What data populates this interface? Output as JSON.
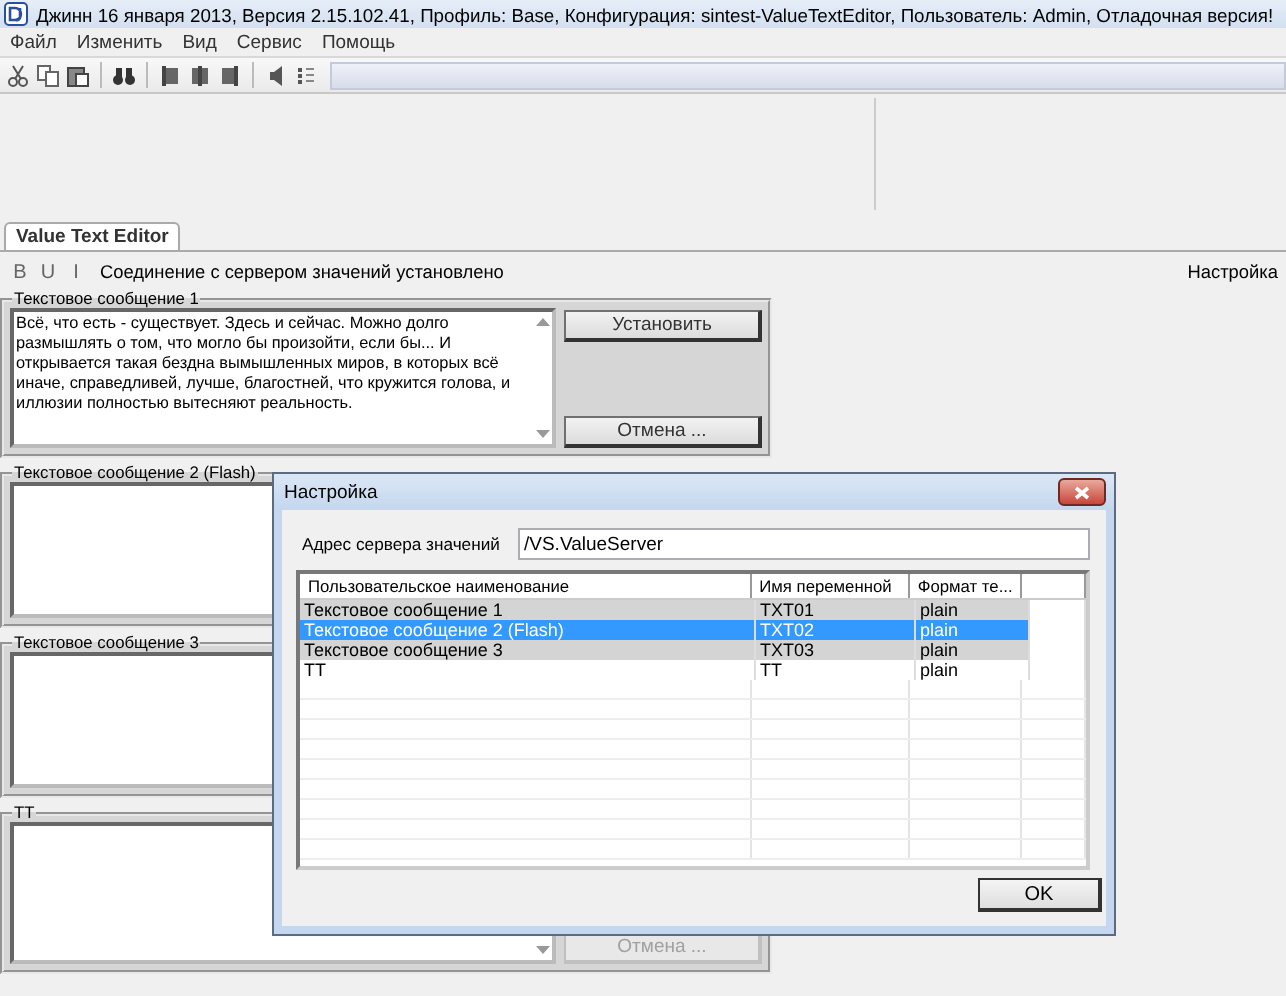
{
  "window": {
    "title": "Джинн 16 января 2013, Версия 2.15.102.41, Профиль: Base, Конфигурация: sintest-ValueTextEditor, Пользователь: Admin, Отладочная версия!"
  },
  "menu": [
    {
      "label": "Файл"
    },
    {
      "label": "Изменить"
    },
    {
      "label": "Вид"
    },
    {
      "label": "Сервис"
    },
    {
      "label": "Помощь"
    }
  ],
  "tabs": [
    {
      "label": "Value Text Editor",
      "selected": true
    }
  ],
  "format_toolbar": {
    "buttons": [
      {
        "label": "B"
      },
      {
        "label": "U"
      },
      {
        "label": "I"
      }
    ],
    "status": "Соединение с сервером значений установлено",
    "settings": "Настройка"
  },
  "messages": [
    {
      "title": "Текстовое сообщение 1",
      "text": "Всё, что есть - существует. Здесь и сейчас. Можно долго размышлять о том, что могло бы произойти, если бы... И открывается такая бездна вымышленных миров, в которых всё иначе, справедливей, лучше, благостней, что кружится голова, и иллюзии полностью вытесняют реальность.",
      "buttons": [
        {
          "kind": "set",
          "label": "Установить",
          "disabled": false
        },
        {
          "kind": "cancel",
          "label": "Отмена ...",
          "disabled": false
        }
      ]
    },
    {
      "title": "Текстовое сообщение 2 (Flash)"
    },
    {
      "title": "Текстовое сообщение 3"
    },
    {
      "title": "TT",
      "buttons": [
        {
          "kind": "cancel",
          "label": "Отмена ...",
          "disabled": true
        }
      ]
    }
  ],
  "dialog": {
    "title": "Настройка",
    "server_label": "Адрес сервера значений",
    "server_value": "/VS.ValueServer",
    "table": {
      "columns": [
        "Пользовательское наименование",
        "Имя переменной",
        "Формат те..."
      ],
      "rows": [
        {
          "cells": [
            "Текстовое сообщение 1",
            "TXT01",
            "plain"
          ],
          "selected": false,
          "shaded": true
        },
        {
          "cells": [
            "Текстовое сообщение 2 (Flash)",
            "TXT02",
            "plain"
          ],
          "selected": true
        },
        {
          "cells": [
            "Текстовое сообщение 3",
            "TXT03",
            "plain"
          ],
          "selected": false,
          "shaded": true
        },
        {
          "cells": [
            "TT",
            "TT",
            "plain"
          ],
          "selected": false,
          "shaded": false
        }
      ]
    },
    "ok": "OK"
  }
}
